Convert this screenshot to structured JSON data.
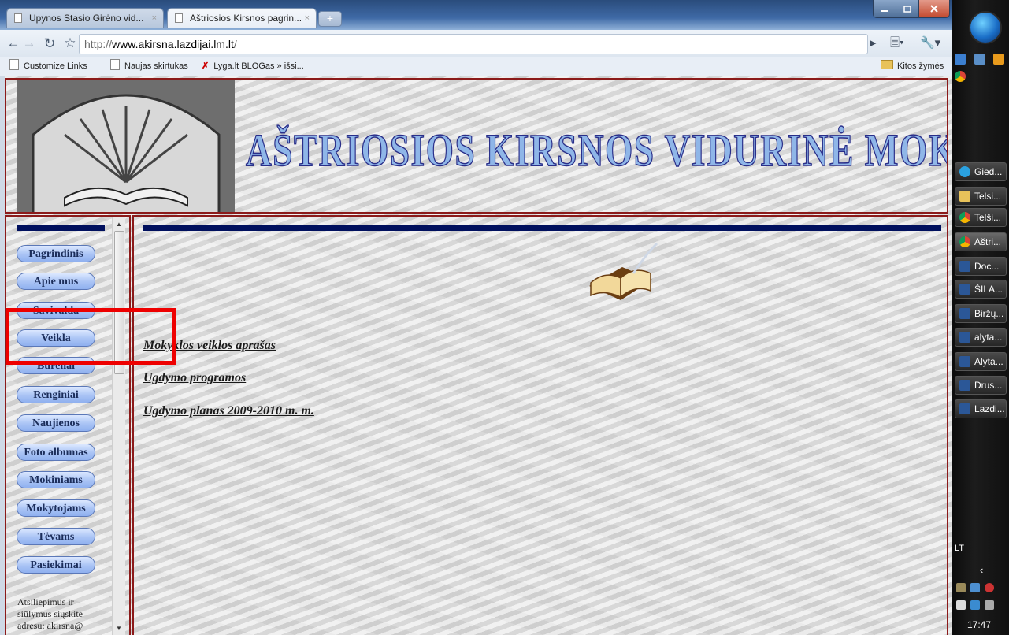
{
  "browser": {
    "tabs": [
      {
        "label": "Upynos Stasio Girėno vid...",
        "active": false
      },
      {
        "label": "Aštriosios Kirsnos pagrin...",
        "active": true
      }
    ],
    "new_tab_label": "+",
    "tab_close_glyph": "×",
    "url": {
      "protocol": "http://",
      "host": "www.akirsna.lazdijai.lm.lt",
      "path": "/"
    },
    "bookmarks": [
      {
        "label": "Customize Links",
        "icon": "page-icon"
      },
      {
        "label": "Naujas skirtukas",
        "icon": "page-icon"
      },
      {
        "label": "Lyga.lt BLOGas » išsi...",
        "icon": "lyga-icon"
      }
    ],
    "other_bookmarks": "Kitos žymės"
  },
  "site": {
    "title": "AŠTRIOSIOS KIRSNOS VIDURINĖ MOKYKLA",
    "nav": [
      "Pagrindinis",
      "Apie mus",
      "Savivalda",
      "Veikla",
      "Būreliai",
      "Renginiai",
      "Naujienos",
      "Foto albumas",
      "Mokiniams",
      "Mokytojams",
      "Tėvams",
      "Pasiekimai"
    ],
    "contact_note": "Atsiliepimus ir siūlymus siųskite adresu: akirsna@",
    "links": [
      "Mokyklos veiklos aprašas",
      "Ugdymo programos",
      "Ugdymo planas 2009-2010 m. m."
    ]
  },
  "taskbar": {
    "items": [
      {
        "label": "Gied...",
        "icon": "messenger-icon"
      },
      {
        "label": "Telsi...",
        "icon": "folder-icon"
      },
      {
        "label": "Telši...",
        "icon": "chrome-icon"
      },
      {
        "label": "Aštri...",
        "icon": "chrome-icon"
      },
      {
        "label": "Doc...",
        "icon": "word-icon"
      },
      {
        "label": "ŠILA...",
        "icon": "word-icon"
      },
      {
        "label": "Biržų...",
        "icon": "word-icon"
      },
      {
        "label": "alyta...",
        "icon": "word-icon"
      },
      {
        "label": "Alyta...",
        "icon": "word-icon"
      },
      {
        "label": "Drus...",
        "icon": "word-icon"
      },
      {
        "label": "Lazdi...",
        "icon": "word-icon"
      }
    ],
    "language": "LT",
    "clock": "17:47"
  },
  "colors": {
    "frame_border": "#8b1a1a",
    "nav_bar": "#00105e",
    "highlight": "#ee0000"
  }
}
